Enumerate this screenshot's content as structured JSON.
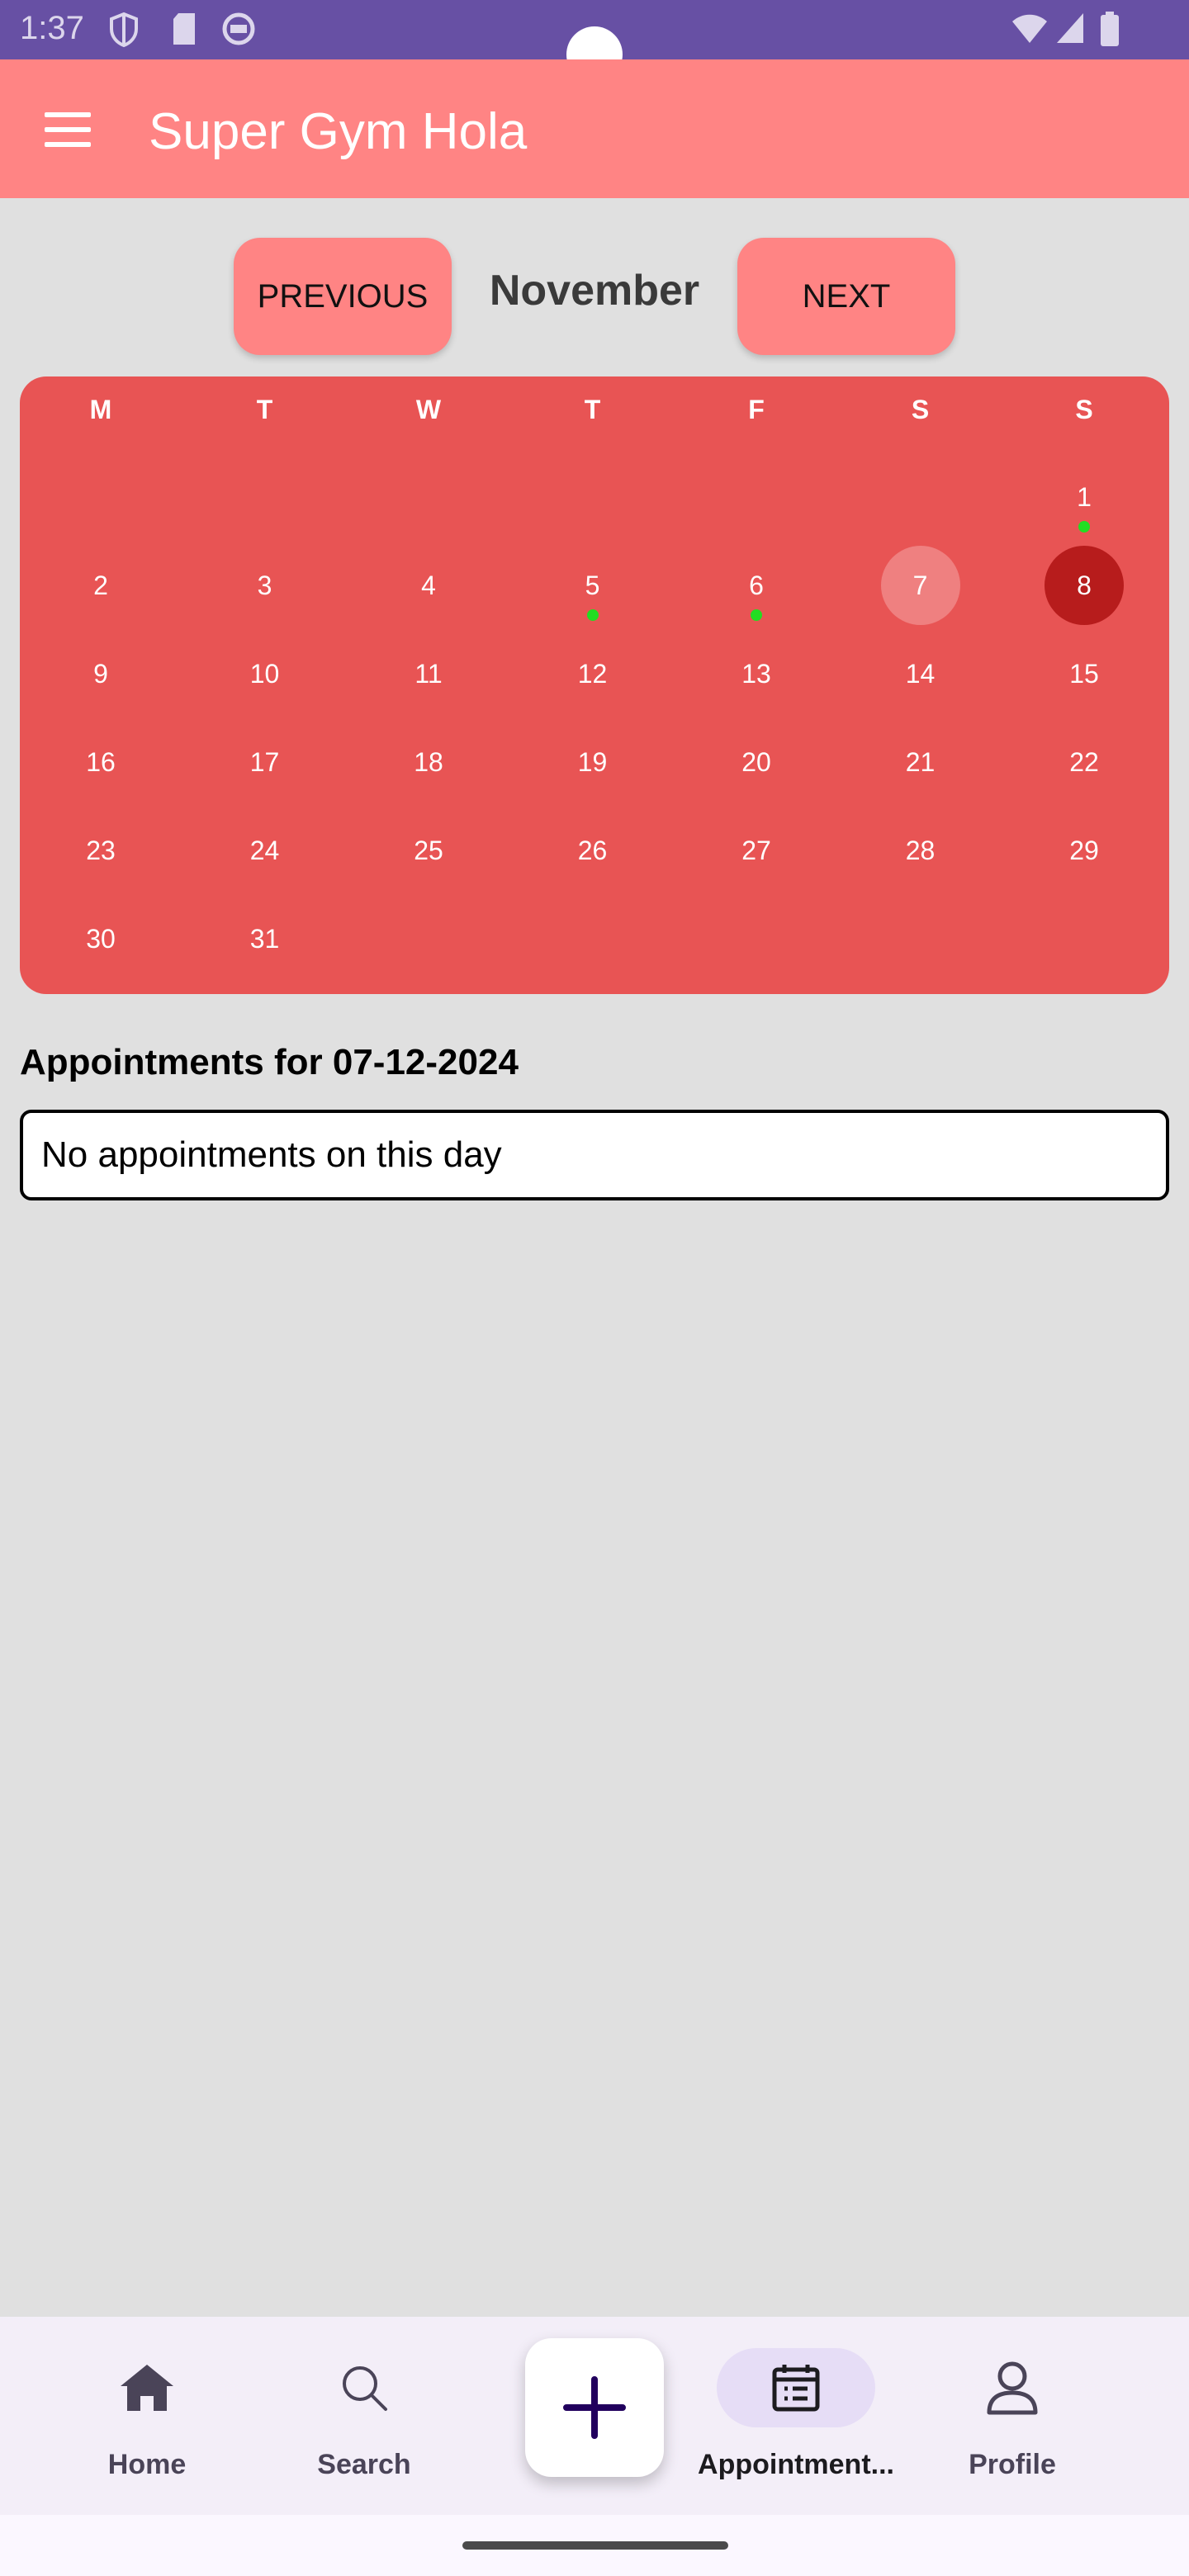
{
  "status_bar": {
    "time": "1:37"
  },
  "app_bar": {
    "title": "Super Gym Hola"
  },
  "month_nav": {
    "previous_label": "PREVIOUS",
    "month": "November",
    "next_label": "NEXT"
  },
  "calendar": {
    "weekdays": [
      "M",
      "T",
      "W",
      "T",
      "F",
      "S",
      "S"
    ],
    "days": [
      "1",
      "2",
      "3",
      "4",
      "5",
      "6",
      "7",
      "8",
      "9",
      "10",
      "11",
      "12",
      "13",
      "14",
      "15",
      "16",
      "17",
      "18",
      "19",
      "20",
      "21",
      "22",
      "23",
      "24",
      "25",
      "26",
      "27",
      "28",
      "29",
      "30",
      "31"
    ],
    "first_weekday_index": 6,
    "today": "7",
    "selected": "8",
    "days_with_appointments": [
      "1",
      "5",
      "6"
    ]
  },
  "appointments": {
    "heading": "Appointments for 07-12-2024",
    "empty_message": "No appointments on this day"
  },
  "bottom_nav": {
    "items": [
      {
        "label": "Home",
        "icon": "home-icon"
      },
      {
        "label": "Search",
        "icon": "search-icon"
      },
      {
        "label": "Appointment...",
        "icon": "calendar-list-icon"
      },
      {
        "label": "Profile",
        "icon": "person-icon"
      }
    ],
    "active": "Appointment...",
    "fab_icon": "plus-icon"
  },
  "colors": {
    "status_bar": "#6750a4",
    "app_bar": "#ff8484",
    "calendar_bg": "#e85454",
    "selected_day": "#b71c1c",
    "today_day": "#ef8080",
    "appointment_dot": "#22dd22",
    "background": "#e0e0e0"
  }
}
